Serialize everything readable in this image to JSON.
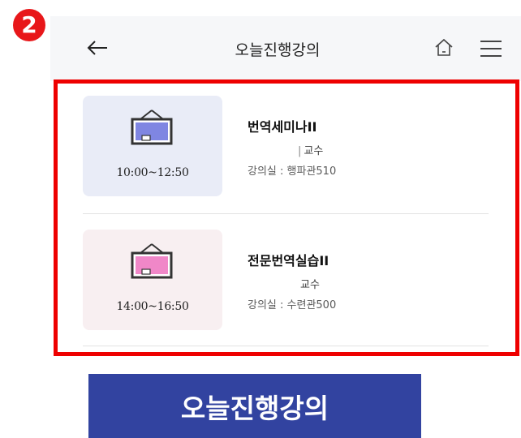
{
  "step_number": "2",
  "header": {
    "title": "오늘진행강의",
    "icons": [
      "back-arrow-icon",
      "home-icon",
      "menu-icon"
    ]
  },
  "courses": [
    {
      "title": "번역세미나II",
      "time": "10:00~12:50",
      "professor_separator": "|",
      "professor_label": "교수",
      "room": "강의실 : 행파관510",
      "thumb_bg": "#e9ecf7",
      "board_color": "#7f86e2"
    },
    {
      "title": "전문번역실습II",
      "time": "14:00~16:50",
      "professor_separator": "",
      "professor_label": "교수",
      "room": "강의실 : 수련관500",
      "thumb_bg": "#f8eff1",
      "board_color": "#f087c8"
    }
  ],
  "caption": "오늘진행강의",
  "colors": {
    "highlight": "#ee0000",
    "step_badge": "#e8171a",
    "caption_bg": "#3243a0"
  }
}
